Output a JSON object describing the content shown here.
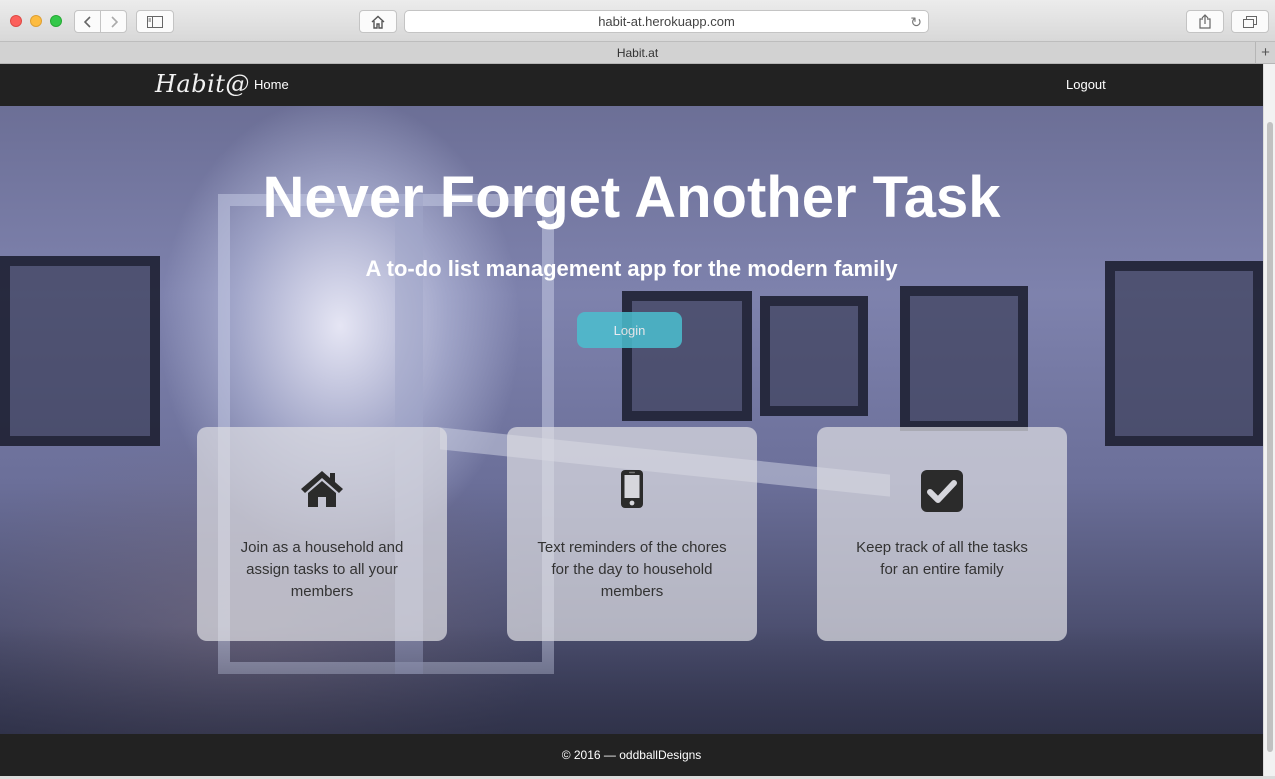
{
  "browser": {
    "url": "habit-at.herokuapp.com",
    "tab_title": "Habit.at"
  },
  "navbar": {
    "brand": "Habit@",
    "home_label": "Home",
    "logout_label": "Logout"
  },
  "hero": {
    "title": "Never Forget Another Task",
    "subtitle": "A to-do list management app for the modern family",
    "login_label": "Login"
  },
  "features": [
    {
      "icon": "home-icon",
      "text": "Join as a household and assign tasks to all your members"
    },
    {
      "icon": "mobile-phone-icon",
      "text": "Text reminders of the chores for the day to household members"
    },
    {
      "icon": "checkbox-checked-icon",
      "text": "Keep track of all the tasks for an entire family"
    }
  ],
  "footer": {
    "text": "© 2016 — oddballDesigns"
  },
  "colors": {
    "navbar": "#222222",
    "accent": "#4bbfcf"
  }
}
